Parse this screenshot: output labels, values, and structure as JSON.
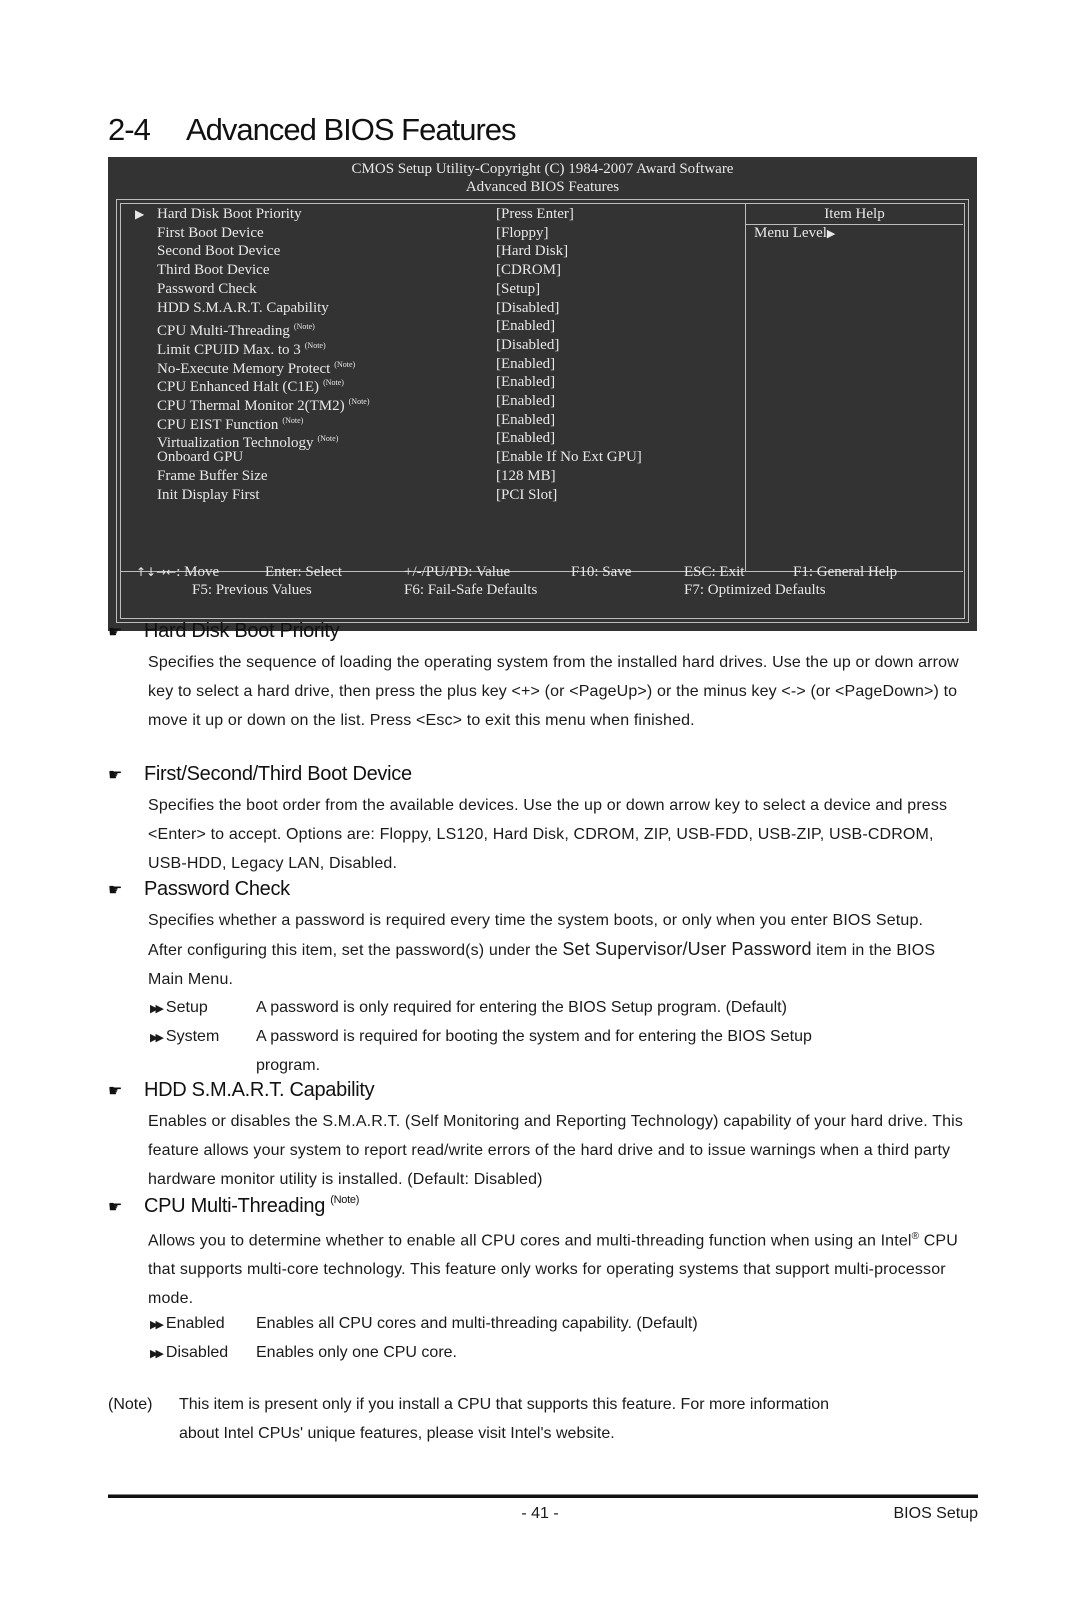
{
  "section": {
    "number": "2-4",
    "title": "Advanced BIOS Features"
  },
  "bios": {
    "header_line1": "CMOS Setup Utility-Copyright (C) 1984-2007 Award Software",
    "header_line2": "Advanced BIOS Features",
    "selected_arrow_icon": "right-triangle",
    "items": [
      {
        "label": "Hard Disk Boot Priority",
        "note": "",
        "value": "[Press Enter]",
        "selected": true
      },
      {
        "label": "First Boot Device",
        "note": "",
        "value": "[Floppy]"
      },
      {
        "label": "Second Boot Device",
        "note": "",
        "value": "[Hard Disk]"
      },
      {
        "label": "Third Boot Device",
        "note": "",
        "value": "[CDROM]"
      },
      {
        "label": "Password Check",
        "note": "",
        "value": "[Setup]"
      },
      {
        "label": "HDD S.M.A.R.T. Capability",
        "note": "",
        "value": "[Disabled]"
      },
      {
        "label": "CPU Multi-Threading",
        "note": "(Note)",
        "value": "[Enabled]"
      },
      {
        "label": "Limit CPUID Max. to 3",
        "note": "(Note)",
        "value": "[Disabled]"
      },
      {
        "label": "No-Execute Memory Protect",
        "note": "(Note)",
        "value": "[Enabled]"
      },
      {
        "label": "CPU Enhanced Halt (C1E)",
        "note": "(Note)",
        "value": "[Enabled]"
      },
      {
        "label": "CPU Thermal Monitor 2(TM2)",
        "note": "(Note)",
        "value": "[Enabled]"
      },
      {
        "label": "CPU EIST Function",
        "note": "(Note)",
        "value": "[Enabled]"
      },
      {
        "label": "Virtualization Technology",
        "note": "(Note)",
        "value": "[Enabled]"
      },
      {
        "label": "Onboard GPU",
        "note": "",
        "value": "[Enable If No Ext GPU]"
      },
      {
        "label": "Frame Buffer Size",
        "note": "",
        "value": "[128 MB]"
      },
      {
        "label": "Init Display First",
        "note": "",
        "value": "[PCI Slot]"
      }
    ],
    "help_title": "Item Help",
    "help_text": "Menu Level",
    "footer_row1": [
      {
        "key": "↑↓→←",
        "text": ": Move"
      },
      {
        "key": "",
        "text": "Enter: Select"
      },
      {
        "key": "",
        "text": "+/-/PU/PD: Value"
      },
      {
        "key": "",
        "text": "F10: Save"
      },
      {
        "key": "",
        "text": "ESC: Exit"
      },
      {
        "key": "",
        "text": "F1: General Help"
      }
    ],
    "footer_row2": [
      {
        "text": "F5: Previous Values"
      },
      {
        "text": "F6: Fail-Safe Defaults"
      },
      {
        "text": "F7: Optimized Defaults"
      }
    ]
  },
  "doc": {
    "hand_icon": "pointing-hand",
    "sections": [
      {
        "title": "Hard Disk Boot Priority",
        "sup": "",
        "body": "Specifies the sequence of loading the operating system from the installed hard drives.  Use the up or down arrow key to select a hard drive, then press the plus key <+> (or <PageUp>) or the minus key <-> (or <PageDown>) to move it up or down on the list. Press <Esc> to exit this menu when finished."
      },
      {
        "title": "First/Second/Third Boot Device",
        "sup": "",
        "body": "Specifies the boot order from the available devices. Use the up or down arrow key to select a device and press <Enter> to accept. Options are: Floppy, LS120, Hard Disk, CDROM, ZIP, USB-FDD, USB-ZIP, USB-CDROM, USB-HDD, Legacy LAN, Disabled."
      },
      {
        "title": "Password Check",
        "sup": "",
        "body_pre": "Specifies whether a password is required every time the system boots, or only when you enter BIOS Setup. After configuring this item, set the password(s) under the ",
        "body_em": "Set Supervisor/User Password",
        "body_post": " item in the BIOS Main Menu.",
        "options": [
          {
            "key": "Setup",
            "desc": "A password is only required for entering the BIOS Setup program. (Default)"
          },
          {
            "key": "System",
            "desc": "A password is required for booting the system and for entering the BIOS Setup",
            "desc2": "program."
          }
        ]
      },
      {
        "title": "HDD S.M.A.R.T. Capability",
        "sup": "",
        "body": "Enables or disables the S.M.A.R.T. (Self Monitoring and Reporting Technology) capability of your hard drive. This feature allows your system to report read/write errors of the hard drive and to issue warnings when a third party hardware monitor utility is installed. (Default: Disabled)"
      },
      {
        "title": "CPU Multi-Threading",
        "sup": "(Note)",
        "body_pre": "Allows you to determine whether to enable all CPU cores and multi-threading function when using an Intel",
        "body_reg": "®",
        "body_post": " CPU that supports multi-core technology. This feature only works for operating systems that support multi-processor mode.",
        "options": [
          {
            "key": "Enabled",
            "desc": "Enables all CPU cores and multi-threading capability. (Default)"
          },
          {
            "key": "Disabled",
            "desc": "Enables only one CPU core."
          }
        ]
      }
    ],
    "note_label": "(Note)",
    "note_line1": "This item is present only if you install a CPU that supports this feature. For more information",
    "note_line2": "about Intel CPUs' unique features, please visit Intel's website."
  },
  "footer": {
    "page": "- 41 -",
    "chapter": "BIOS Setup"
  }
}
